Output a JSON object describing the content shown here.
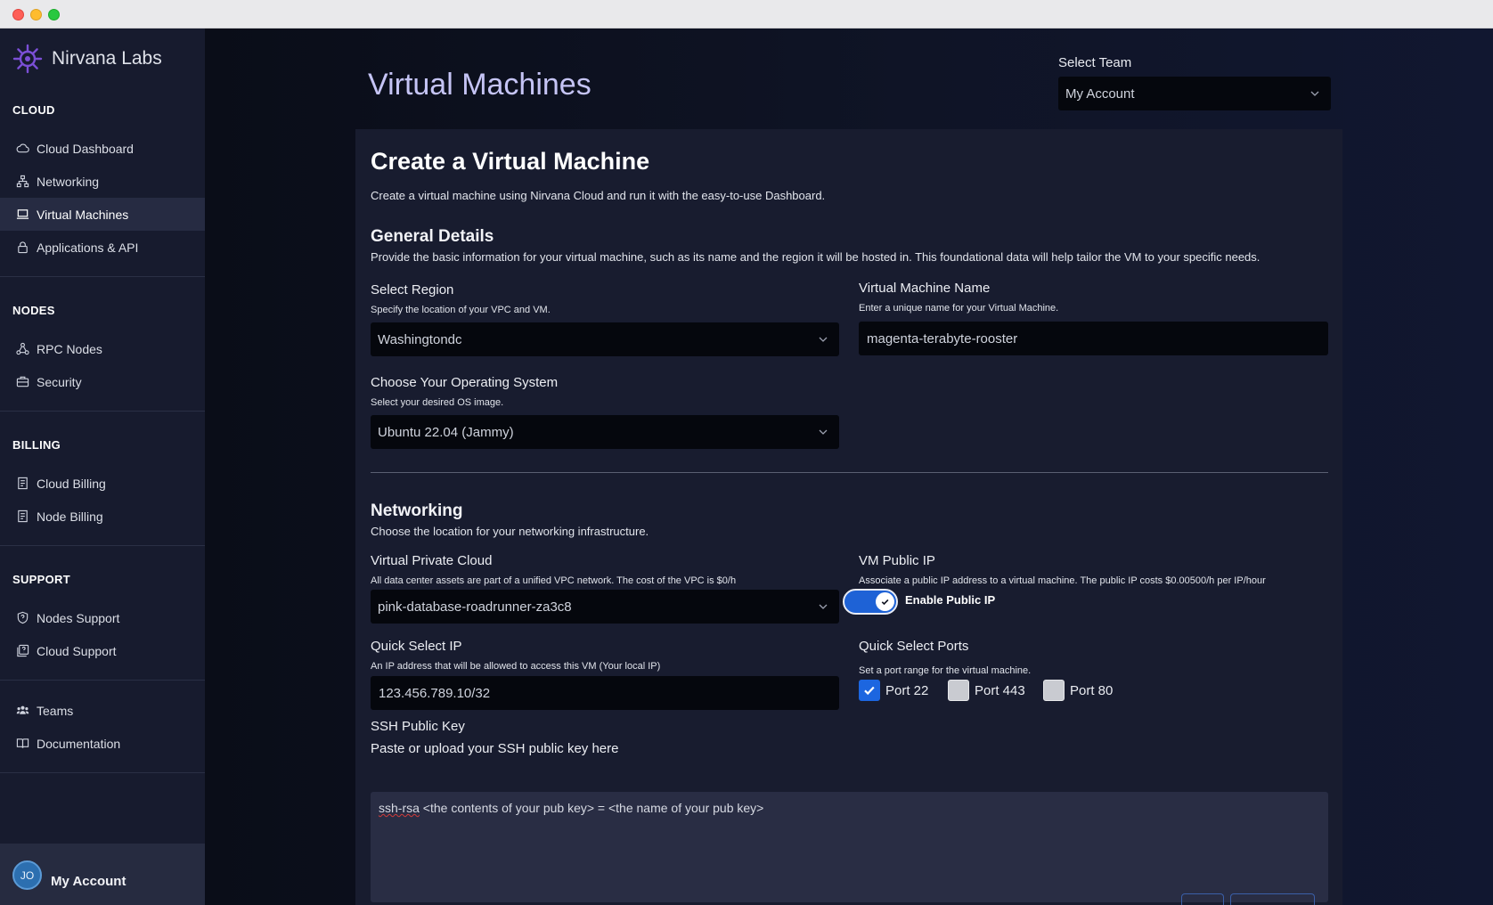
{
  "brand": {
    "name": "Nirvana Labs"
  },
  "sidebar": {
    "sections": {
      "cloud": "CLOUD",
      "nodes": "NODES",
      "billing": "BILLING",
      "support": "SUPPORT"
    },
    "items": {
      "cloud_dashboard": "Cloud Dashboard",
      "networking": "Networking",
      "virtual_machines": "Virtual Machines",
      "applications_api": "Applications & API",
      "rpc_nodes": "RPC Nodes",
      "security": "Security",
      "cloud_billing": "Cloud Billing",
      "node_billing": "Node Billing",
      "nodes_support": "Nodes Support",
      "cloud_support": "Cloud Support",
      "teams": "Teams",
      "documentation": "Documentation"
    },
    "active": "virtual_machines",
    "account": {
      "initials": "JO",
      "name": "My Account"
    }
  },
  "header": {
    "title": "Virtual Machines",
    "team_label": "Select Team",
    "team_value": "My Account"
  },
  "form": {
    "title": "Create a Virtual Machine",
    "subtitle": "Create a virtual machine using Nirvana Cloud and run it with the easy-to-use Dashboard.",
    "general": {
      "heading": "General Details",
      "description": "Provide the basic information for your virtual machine, such as its name and the region it will be hosted in. This foundational data will help tailor the VM to your specific needs.",
      "region_label": "Select Region",
      "region_help": "Specify the location of your VPC and VM.",
      "region_value": "Washingtondc",
      "name_label": "Virtual Machine Name",
      "name_help": "Enter a unique name for your Virtual Machine.",
      "name_value": "magenta-terabyte-rooster",
      "os_label": "Choose Your Operating System",
      "os_help": "Select your desired OS image.",
      "os_value": "Ubuntu 22.04 (Jammy)"
    },
    "networking": {
      "heading": "Networking",
      "description": "Choose the location for your networking infrastructure.",
      "vpc_label": "Virtual Private Cloud",
      "vpc_help": "All data center assets are part of a unified VPC network. The cost of the VPC is $0/h",
      "vpc_value": "pink-database-roadrunner-za3c8",
      "public_ip_label": "VM Public IP",
      "public_ip_help": "Associate a public IP address to a virtual machine. The public IP costs $0.00500/h per IP/hour",
      "public_ip_toggle_label": "Enable Public IP",
      "public_ip_enabled": true,
      "quick_ip_label": "Quick Select IP",
      "quick_ip_help": "An IP address that will be allowed to access this VM (Your local IP)",
      "quick_ip_value": "123.456.789.10/32",
      "ports_label": "Quick Select Ports",
      "ports_help": "Set a port range for the virtual machine.",
      "ports": [
        {
          "label": "Port 22",
          "checked": true
        },
        {
          "label": "Port 443",
          "checked": false
        },
        {
          "label": "Port 80",
          "checked": false
        }
      ],
      "ssh_label": "SSH Public Key",
      "ssh_help": "Paste or upload your SSH public key here",
      "ssh_placeholder_word": "ssh-rsa",
      "ssh_placeholder_rest": " <the contents of your pub key> = <the name of your pub key>"
    }
  },
  "colors": {
    "accent": "#1e62d6",
    "brand_logo": "#7b4fd6",
    "title": "#c5c4f5"
  }
}
